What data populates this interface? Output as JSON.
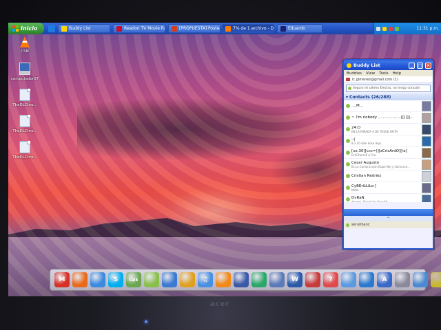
{
  "taskbar": {
    "start_label": "Inicio",
    "tasks": [
      {
        "label": "Buddy List",
        "icon_color": "#ffd400"
      },
      {
        "label": "Readon TV Movie Ra...",
        "icon_color": "#c8102e"
      },
      {
        "label": "[PROPUESTA] Postea...",
        "icon_color": "#d04020"
      },
      {
        "label": "7% de 1 archivo - De...",
        "icon_color": "#ff7b00"
      },
      {
        "label": "Eduardo",
        "icon_color": "#1e1e6e"
      }
    ],
    "clock": "11:31 p.m."
  },
  "desktop_icons": [
    {
      "label": "CSN",
      "icon": "traffic-cone-icon"
    },
    {
      "label": "computador07",
      "icon": "computer-icon"
    },
    {
      "label": "TheDLChro...",
      "icon": "file-icon"
    },
    {
      "label": "TheDLChro...",
      "icon": "file-icon"
    },
    {
      "label": "TheDLChro...",
      "icon": "file-icon"
    }
  ],
  "buddy_list": {
    "title": "Buddy List",
    "menu": [
      "Buddies",
      "View",
      "Tools",
      "Help"
    ],
    "account": "lc.gimenez@gmail.com (1)",
    "status_message": "Seguin mi ultimo Electro, no tengo corazón",
    "group": {
      "label": "Contacts (26/288)"
    },
    "contacts": [
      {
        "name": "....M...",
        "status_message": "",
        "status_color": "#8bc34a",
        "avatar_color": "#7a7aa0"
      },
      {
        "name": "~ I'm nobody ...................[[[]]]...",
        "status_message": "",
        "status_color": "#8bc34a",
        "avatar_color": "#b0a0a0"
      },
      {
        "name": "24:D",
        "status_message": "EN LA MIRADA A DE YOSUE AKITA",
        "status_color": "#8bc34a",
        "avatar_color": "#3a4a6a"
      },
      {
        "name": "-:|",
        "status_message": "8 a 10 dale dose dejo",
        "status_color": "#8bc34a",
        "avatar_color": "#2a6aa8"
      },
      {
        "name": "[xx:30][ccc=)][zCrisArdO][/a]",
        "status_message": "EchCharreE a Feo",
        "status_color": "#8bc34a",
        "avatar_color": "#8a6a4a"
      },
      {
        "name": "Cesar Augusto",
        "status_message": "Es La Construccion Dope Nej y Llamaron...",
        "status_color": "#8bc34a",
        "avatar_color": "#c8a080"
      },
      {
        "name": "Cristian Redriez",
        "status_message": "",
        "status_color": "#8bc34a",
        "avatar_color": "#d0d0d8"
      },
      {
        "name": "CyBEr&LiLo:]",
        "status_message": "MHzL",
        "status_color": "#8bc34a",
        "avatar_color": "#6a6a8a"
      },
      {
        "name": "DvRaN",
        "status_message": "de wes, Sound Un Una (H)",
        "status_color": "#8bc34a",
        "avatar_color": "#4a6a9a"
      }
    ],
    "bottom_label": "seruribanc"
  },
  "dock": {
    "items": [
      {
        "icon": "gmail-icon",
        "glyph": "M",
        "color": "#d93025"
      },
      {
        "icon": "firefox-icon",
        "glyph": "",
        "color": "#e86a1a"
      },
      {
        "icon": "safari-icon",
        "glyph": "",
        "color": "#3a8ae0"
      },
      {
        "icon": "skype-icon",
        "glyph": "S",
        "color": "#00aff0"
      },
      {
        "icon": "gtalk-icon",
        "glyph": "talk",
        "color": "#6aa84f"
      },
      {
        "icon": "bucket-icon",
        "glyph": "",
        "color": "#8ac04a"
      },
      {
        "icon": "swirl-icon",
        "glyph": "",
        "color": "#3a7ad0"
      },
      {
        "icon": "pencil-icon",
        "glyph": "",
        "color": "#e0a020"
      },
      {
        "icon": "itunes-icon",
        "glyph": "♫",
        "color": "#4a90e2"
      },
      {
        "icon": "vlc-icon",
        "glyph": "",
        "color": "#f08a1a"
      },
      {
        "icon": "monitor-icon",
        "glyph": "",
        "color": "#3a5aa8"
      },
      {
        "icon": "disk-icon",
        "glyph": "",
        "color": "#2aa86a"
      },
      {
        "icon": "mail-icon",
        "glyph": "",
        "color": "#5a7ab8"
      },
      {
        "icon": "word-icon",
        "glyph": "W",
        "color": "#2a5aa8"
      },
      {
        "icon": "no-icon",
        "glyph": "",
        "color": "#c83a3a"
      },
      {
        "icon": "help-icon",
        "glyph": "?",
        "color": "#e04a4a"
      },
      {
        "icon": "bird-icon",
        "glyph": "",
        "color": "#5a9ae0"
      },
      {
        "icon": "windows-icon",
        "glyph": "",
        "color": "#2a7ad0"
      },
      {
        "icon": "app-store-icon",
        "glyph": "A",
        "color": "#3a6ac8"
      },
      {
        "icon": "trash-icon",
        "glyph": "",
        "color": "#8a8a9a"
      },
      {
        "icon": "folder-icon",
        "glyph": "",
        "color": "#4a8ad0"
      },
      {
        "icon": "road-sign-icon",
        "glyph": "",
        "color": "#c8b830"
      },
      {
        "icon": "stack-icon",
        "glyph": "",
        "color": "#9a8a70"
      }
    ]
  },
  "bezel": {
    "brand": "acer"
  },
  "colors": {
    "taskbar": "#2456c8",
    "start": "#3a9a3a",
    "window_border": "#2a5cd8"
  }
}
